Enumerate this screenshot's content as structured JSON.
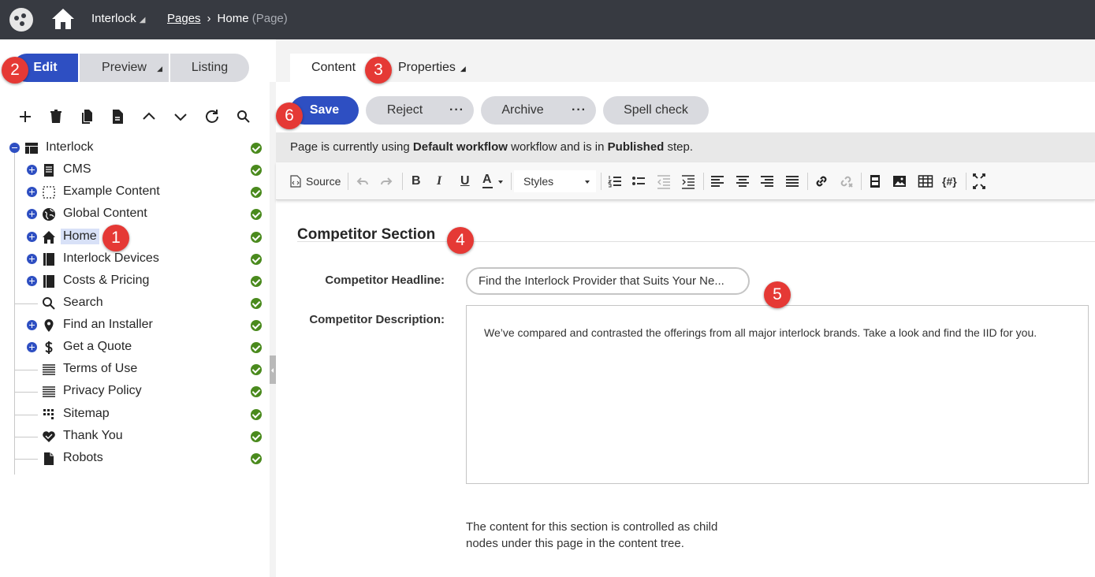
{
  "topbar": {
    "site_name": "Interlock",
    "breadcrumb_link": "Pages",
    "breadcrumb_current": "Home",
    "breadcrumb_type": "(Page)",
    "icons": [
      "logo-icon",
      "home-icon",
      "chevron-right-icon"
    ]
  },
  "mode_tabs": {
    "edit": "Edit",
    "preview": "Preview",
    "listing": "Listing",
    "active": "Edit"
  },
  "tree_toolbar": {
    "icons": [
      "plus-icon",
      "trash-icon",
      "copy-icon",
      "document-icon",
      "chevron-up-icon",
      "chevron-down-icon",
      "refresh-icon",
      "search-icon"
    ]
  },
  "tree": {
    "root": "Interlock",
    "items": [
      {
        "label": "CMS",
        "icon": "document-list-icon",
        "expandable": true
      },
      {
        "label": "Example Content",
        "icon": "dashed-box-icon",
        "expandable": true
      },
      {
        "label": "Global Content",
        "icon": "globe-icon",
        "expandable": true
      },
      {
        "label": "Home",
        "icon": "home-icon",
        "expandable": true,
        "selected": true
      },
      {
        "label": "Interlock Devices",
        "icon": "book-icon",
        "expandable": true
      },
      {
        "label": "Costs & Pricing",
        "icon": "book-icon",
        "expandable": true
      },
      {
        "label": "Search",
        "icon": "search-icon",
        "expandable": false
      },
      {
        "label": "Find an Installer",
        "icon": "map-pin-icon",
        "expandable": true
      },
      {
        "label": "Get a Quote",
        "icon": "dollar-icon",
        "expandable": true
      },
      {
        "label": "Terms of Use",
        "icon": "lines-icon",
        "expandable": false
      },
      {
        "label": "Privacy Policy",
        "icon": "lines-icon",
        "expandable": false
      },
      {
        "label": "Sitemap",
        "icon": "grid-icon",
        "expandable": false
      },
      {
        "label": "Thank You",
        "icon": "heart-hands-icon",
        "expandable": false
      },
      {
        "label": "Robots",
        "icon": "file-icon",
        "expandable": false
      }
    ],
    "status_color": "#4a8a1d"
  },
  "content_tabs": {
    "content": "Content",
    "properties": "Properties",
    "active": "Content"
  },
  "actions": {
    "save": "Save",
    "reject": "Reject",
    "archive": "Archive",
    "spell_check": "Spell check"
  },
  "workflow": {
    "prefix": "Page is currently using ",
    "workflow_name": "Default workflow",
    "middle": " workflow and is in ",
    "step": "Published",
    "suffix": " step."
  },
  "editor_toolbar": {
    "source_label": "Source",
    "styles_label": "Styles",
    "icons": [
      "source-icon",
      "undo-icon",
      "redo-icon",
      "bold-icon",
      "italic-icon",
      "underline-icon",
      "text-color-icon",
      "numbered-list-icon",
      "bulleted-list-icon",
      "outdent-icon",
      "indent-icon",
      "align-left-icon",
      "align-center-icon",
      "align-right-icon",
      "justify-icon",
      "link-icon",
      "unlink-icon",
      "media-icon",
      "image-icon",
      "table-icon",
      "macro-icon",
      "maximize-icon"
    ]
  },
  "form": {
    "section_title": "Competitor Section",
    "headline_label": "Competitor Headline:",
    "headline_value": "Find the Interlock Provider that Suits Your Ne...",
    "description_label": "Competitor Description:",
    "description_value": "We’ve compared and contrasted the offerings from all major interlock brands. Take a look and find the IID for you.",
    "note": "The content for this section is controlled as child nodes under this page in the content tree."
  },
  "markers": [
    "1",
    "2",
    "3",
    "4",
    "5",
    "6"
  ],
  "colors": {
    "topbar": "#373a41",
    "primary": "#2e4fc2",
    "marker": "#e53935"
  }
}
